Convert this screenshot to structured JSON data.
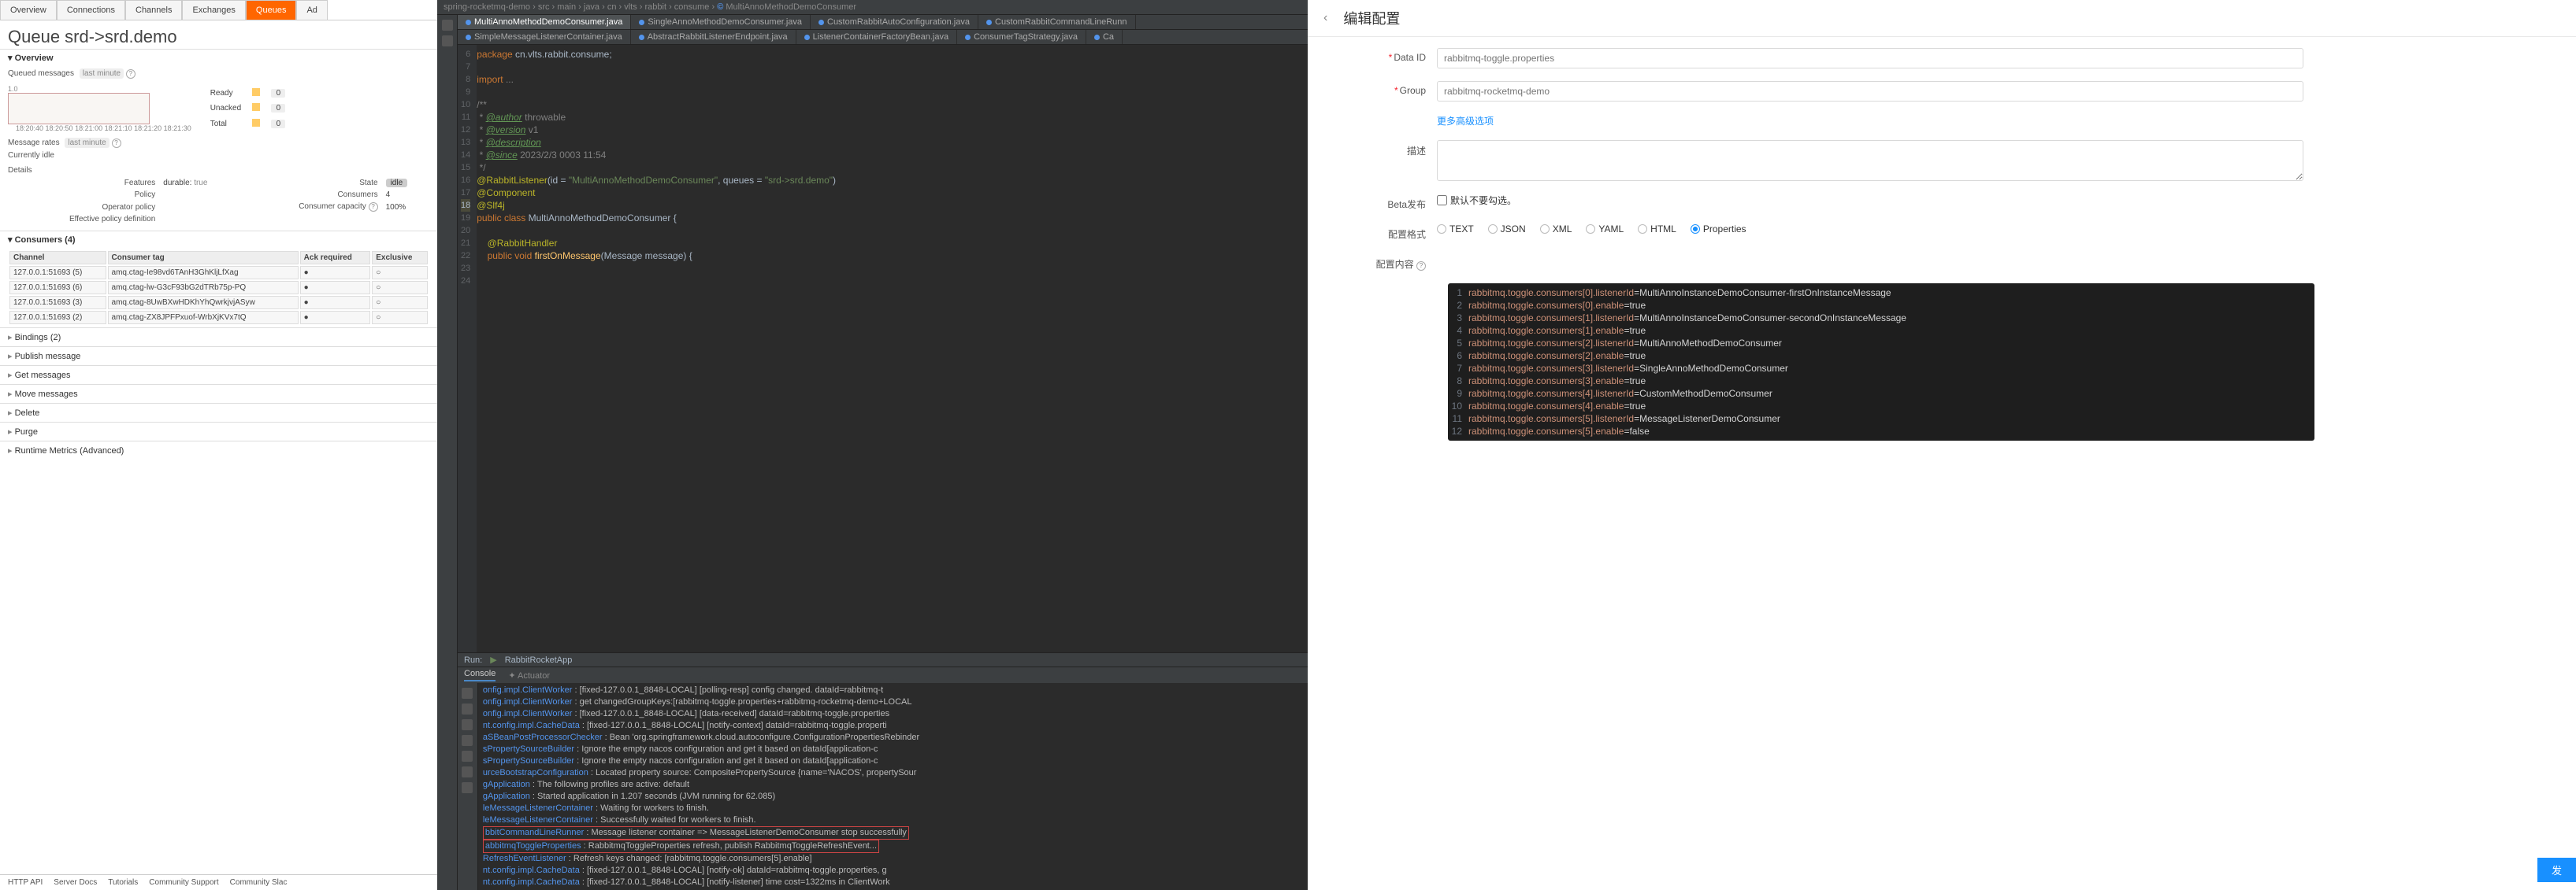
{
  "rabbit": {
    "tabs": [
      "Overview",
      "Connections",
      "Channels",
      "Exchanges",
      "Queues",
      "Ad"
    ],
    "active_tab": 4,
    "title": "Queue srd->srd.demo",
    "overview_label": "Overview",
    "queued_label": "Queued messages",
    "last_minute": "last minute",
    "chart_ylabel": "1.0",
    "chart_x": "18:20:40  18:20:50  18:21:00  18:21:10  18:21:20  18:21:30",
    "legend": {
      "ready": "Ready",
      "unacked": "Unacked",
      "total": "Total",
      "v": "0"
    },
    "msg_rates_label": "Message rates",
    "idle": "Currently idle",
    "details": "Details",
    "d": {
      "features": "Features",
      "durable": "durable:",
      "durable_v": "true",
      "policy": "Policy",
      "op_policy": "Operator policy",
      "epd": "Effective policy definition",
      "state": "State",
      "state_v": "idle",
      "consumers": "Consumers",
      "consumers_v": "4",
      "cap": "Consumer capacity",
      "cap_v": "100%"
    },
    "consumers_title": "Consumers (4)",
    "cth": {
      "ch": "Channel",
      "tag": "Consumer tag",
      "ack": "Ack required",
      "ex": "Exclusive"
    },
    "crows": [
      {
        "ch": "127.0.0.1:51693 (5)",
        "tag": "amq.ctag-Ie98vd6TAnH3GhKljLfXag",
        "ack": "●",
        "ex": "○"
      },
      {
        "ch": "127.0.0.1:51693 (6)",
        "tag": "amq.ctag-lw-G3cF93bG2dTRb75p-PQ",
        "ack": "●",
        "ex": "○"
      },
      {
        "ch": "127.0.0.1:51693 (3)",
        "tag": "amq.ctag-8UwBXwHDKhYhQwrkjvjASyw",
        "ack": "●",
        "ex": "○"
      },
      {
        "ch": "127.0.0.1:51693 (2)",
        "tag": "amq.ctag-ZX8JPFPxuof-WrbXjKVx7tQ",
        "ack": "●",
        "ex": "○"
      }
    ],
    "actions": [
      "Bindings (2)",
      "Publish message",
      "Get messages",
      "Move messages",
      "Delete",
      "Purge",
      "Runtime Metrics (Advanced)"
    ],
    "footer": [
      "HTTP API",
      "Server Docs",
      "Tutorials",
      "Community Support",
      "Community Slac"
    ]
  },
  "ide": {
    "breadcrumb": "spring-rocketmq-demo  ›  src  ›  main  ›  java  ›  cn  ›  vlts  ›  rabbit  ›  consume  ›  ",
    "breadcrumb_cls": "MultiAnnoMethodDemoConsumer",
    "tabs_row1": [
      "MultiAnnoMethodDemoConsumer.java",
      "SingleAnnoMethodDemoConsumer.java",
      "CustomRabbitAutoConfiguration.java",
      "CustomRabbitCommandLineRunn"
    ],
    "tabs_row2": [
      "SimpleMessageListenerContainer.java",
      "AbstractRabbitListenerEndpoint.java",
      "ListenerContainerFactoryBean.java",
      "ConsumerTagStrategy.java",
      "Ca"
    ],
    "gutter": [
      6,
      7,
      8,
      9,
      10,
      11,
      12,
      13,
      14,
      15,
      16,
      17,
      18,
      19,
      20,
      21,
      22,
      23,
      24
    ],
    "hl_line": 18,
    "code": [
      {
        "t": "package ",
        "c": "kw"
      },
      {
        "t": "cn.vlts.rabbit.consume;\n\n",
        "c": ""
      },
      {
        "t": "import ",
        "c": "kw"
      },
      {
        "t": "...\n\n",
        "c": "cm"
      },
      {
        "t": "/**\n",
        "c": "cm"
      },
      {
        "t": " * ",
        "c": "cm"
      },
      {
        "t": "@author",
        "c": "cmtag"
      },
      {
        "t": " throwable\n",
        "c": "cm"
      },
      {
        "t": " * ",
        "c": "cm"
      },
      {
        "t": "@version",
        "c": "cmtag"
      },
      {
        "t": " v1\n",
        "c": "cm"
      },
      {
        "t": " * ",
        "c": "cm"
      },
      {
        "t": "@description",
        "c": "cmtag"
      },
      {
        "t": "\n",
        "c": "cm"
      },
      {
        "t": " * ",
        "c": "cm"
      },
      {
        "t": "@since",
        "c": "cmtag"
      },
      {
        "t": " 2023/2/3 0003 11:54\n",
        "c": "cm"
      },
      {
        "t": " */\n",
        "c": "cm"
      },
      {
        "t": "@RabbitListener",
        "c": "ann"
      },
      {
        "t": "(id = ",
        "c": ""
      },
      {
        "t": "\"MultiAnnoMethodDemoConsumer\"",
        "c": "str"
      },
      {
        "t": ", queues = ",
        "c": ""
      },
      {
        "t": "\"srd->srd.demo\"",
        "c": "str"
      },
      {
        "t": ")\n",
        "c": ""
      },
      {
        "t": "@Component\n",
        "c": "ann"
      },
      {
        "t": "@Slf4j\n",
        "c": "ann"
      },
      {
        "t": "public class ",
        "c": "kw"
      },
      {
        "t": "MultiAnnoMethodDemoConsumer {\n\n",
        "c": "typ"
      },
      {
        "t": "    @RabbitHandler\n",
        "c": "ann"
      },
      {
        "t": "    public void ",
        "c": "kw"
      },
      {
        "t": "firstOnMessage",
        "c": "fn"
      },
      {
        "t": "(Message message) {\n",
        "c": ""
      }
    ],
    "run_label": "Run:",
    "run_app": "RabbitRocketApp",
    "subtabs": {
      "console": "Console",
      "actuator": "Actuator"
    },
    "log": [
      {
        "c": "onfig.impl.ClientWorker",
        "t": ": [fixed-127.0.0.1_8848-LOCAL] [polling-resp] config changed. dataId=rabbitmq-t"
      },
      {
        "c": "onfig.impl.ClientWorker",
        "t": ": get changedGroupKeys:[rabbitmq-toggle.properties+rabbitmq-rocketmq-demo+LOCAL"
      },
      {
        "c": "onfig.impl.ClientWorker",
        "t": ": [fixed-127.0.0.1_8848-LOCAL] [data-received] dataId=rabbitmq-toggle.properties"
      },
      {
        "c": "",
        "t": ""
      },
      {
        "c": "nt.config.impl.CacheData",
        "t": ": [fixed-127.0.0.1_8848-LOCAL] [notify-context] dataId=rabbitmq-toggle.properti"
      },
      {
        "c": "aSBeanPostProcessorChecker",
        "t": ": Bean 'org.springframework.cloud.autoconfigure.ConfigurationPropertiesRebinder"
      },
      {
        "c": "sPropertySourceBuilder",
        "t": ": Ignore the empty nacos configuration and get it based on dataId[application-c"
      },
      {
        "c": "sPropertySourceBuilder",
        "t": ": Ignore the empty nacos configuration and get it based on dataId[application-c"
      },
      {
        "c": "urceBootstrapConfiguration",
        "t": ": Located property source: CompositePropertySource {name='NACOS', propertySour"
      },
      {
        "c": "gApplication",
        "t": ": The following profiles are active: default"
      },
      {
        "c": "gApplication",
        "t": ": Started application in 1.207 seconds (JVM running for 62.085)"
      },
      {
        "c": "leMessageListenerContainer",
        "t": ": Waiting for workers to finish."
      },
      {
        "c": "leMessageListenerContainer",
        "t": ": Successfully waited for workers to finish."
      },
      {
        "c": "bbitCommandLineRunner",
        "t": ": Message listener container => MessageListenerDemoConsumer stop successfully",
        "box": true
      },
      {
        "c": "abbitmqToggleProperties",
        "t": ": RabbitmqToggleProperties refresh, publish RabbitmqToggleRefreshEvent...",
        "box": true
      },
      {
        "c": "RefreshEventListener",
        "t": ": Refresh keys changed: [rabbitmq.toggle.consumers[5].enable]"
      },
      {
        "c": "nt.config.impl.CacheData",
        "t": ": [fixed-127.0.0.1_8848-LOCAL] [notify-ok] dataId=rabbitmq-toggle.properties, g"
      },
      {
        "c": "nt.config.impl.CacheData",
        "t": ": [fixed-127.0.0.1_8848-LOCAL] [notify-listener] time cost=1322ms in ClientWork"
      }
    ]
  },
  "nacos": {
    "title": "编辑配置",
    "labels": {
      "dataid": "Data ID",
      "group": "Group",
      "more": "更多高级选项",
      "desc": "描述",
      "beta": "Beta发布",
      "beta_v": "默认不要勾选。",
      "fmt": "配置格式",
      "content": "配置内容"
    },
    "placeholders": {
      "dataid": "rabbitmq-toggle.properties",
      "group": "rabbitmq-rocketmq-demo"
    },
    "formats": [
      "TEXT",
      "JSON",
      "XML",
      "YAML",
      "HTML",
      "Properties"
    ],
    "fmt_selected": 5,
    "props": [
      "rabbitmq.toggle.consumers[0].listenerId=MultiAnnoInstanceDemoConsumer-firstOnInstanceMessage",
      "rabbitmq.toggle.consumers[0].enable=true",
      "rabbitmq.toggle.consumers[1].listenerId=MultiAnnoInstanceDemoConsumer-secondOnInstanceMessage",
      "rabbitmq.toggle.consumers[1].enable=true",
      "rabbitmq.toggle.consumers[2].listenerId=MultiAnnoMethodDemoConsumer",
      "rabbitmq.toggle.consumers[2].enable=true",
      "rabbitmq.toggle.consumers[3].listenerId=SingleAnnoMethodDemoConsumer",
      "rabbitmq.toggle.consumers[3].enable=true",
      "rabbitmq.toggle.consumers[4].listenerId=CustomMethodDemoConsumer",
      "rabbitmq.toggle.consumers[4].enable=true",
      "rabbitmq.toggle.consumers[5].listenerId=MessageListenerDemoConsumer",
      "rabbitmq.toggle.consumers[5].enable=false"
    ],
    "btn": "发"
  },
  "chart_data": {
    "type": "line",
    "title": "Queued messages (last minute)",
    "x": [
      "18:20:40",
      "18:20:50",
      "18:21:00",
      "18:21:10",
      "18:21:20",
      "18:21:30"
    ],
    "series": [
      {
        "name": "Ready",
        "values": [
          0,
          0,
          0,
          0,
          0,
          0
        ]
      },
      {
        "name": "Unacked",
        "values": [
          0,
          0,
          0,
          0,
          0,
          0
        ]
      },
      {
        "name": "Total",
        "values": [
          0,
          0,
          0,
          0,
          0,
          0
        ]
      }
    ],
    "ylim": [
      0,
      1
    ]
  }
}
